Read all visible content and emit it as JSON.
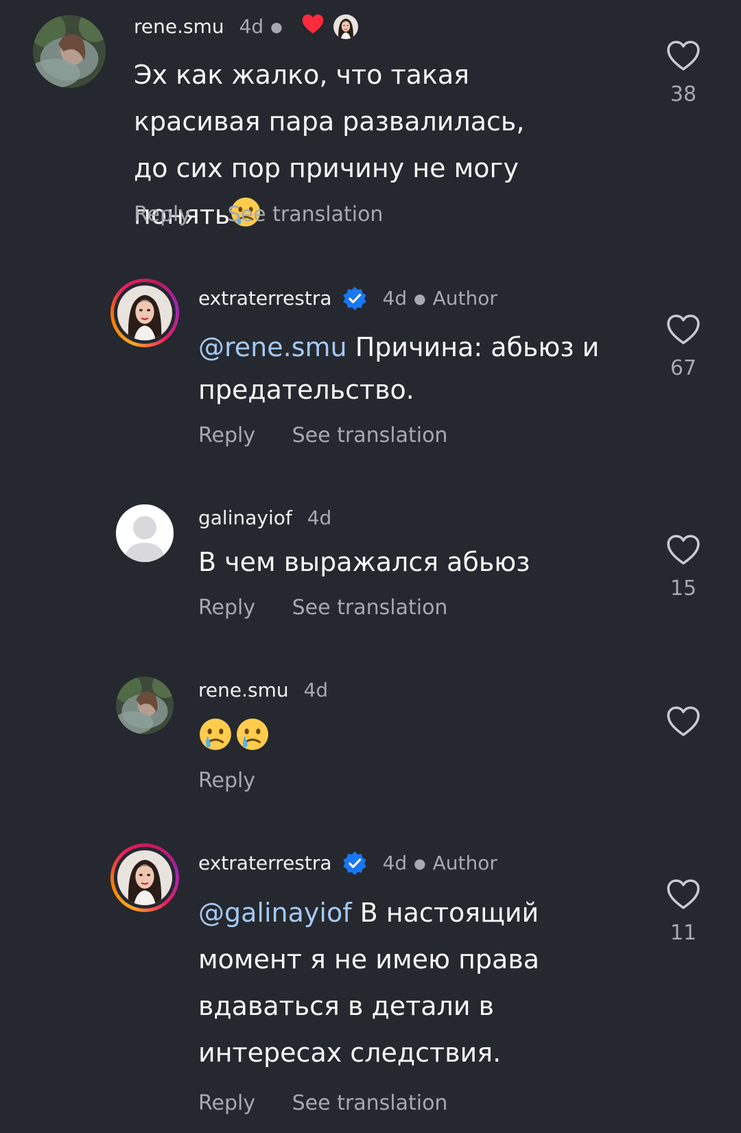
{
  "comments": [
    {
      "username": "rene.smu",
      "time": "4d",
      "text": "Эх как жалко, что такая красивая пара развалилась, до сих пор причину не могу понять",
      "emoji": "crying-face",
      "reply_label": "Reply",
      "translate_label": "See translation",
      "likes": "38",
      "liked_by_author": true
    },
    {
      "username": "extraterrestra",
      "time": "4d",
      "author_label": "Author",
      "verified": true,
      "mention": "@rene.smu",
      "text": " Причина: абьюз и предательство.",
      "reply_label": "Reply",
      "translate_label": "See translation",
      "likes": "67"
    },
    {
      "username": "galinayiof",
      "time": "4d",
      "text": "В чем выражался абьюз",
      "reply_label": "Reply",
      "translate_label": "See translation",
      "likes": "15"
    },
    {
      "username": "rene.smu",
      "time": "4d",
      "emojis": [
        "crying-face",
        "crying-face"
      ],
      "reply_label": "Reply",
      "likes": ""
    },
    {
      "username": "extraterrestra",
      "time": "4d",
      "author_label": "Author",
      "verified": true,
      "mention": "@galinayiof",
      "text": " В настоящий момент я не имею права вдаваться в детали в интересах следствия.",
      "reply_label": "Reply",
      "translate_label": "See translation",
      "likes": "11"
    }
  ],
  "colors": {
    "background": "#25282e",
    "mention": "#a5c8f5",
    "muted": "#a6a9b0",
    "verified": "#1877f2",
    "heart_liked": "#ff2b3d"
  }
}
